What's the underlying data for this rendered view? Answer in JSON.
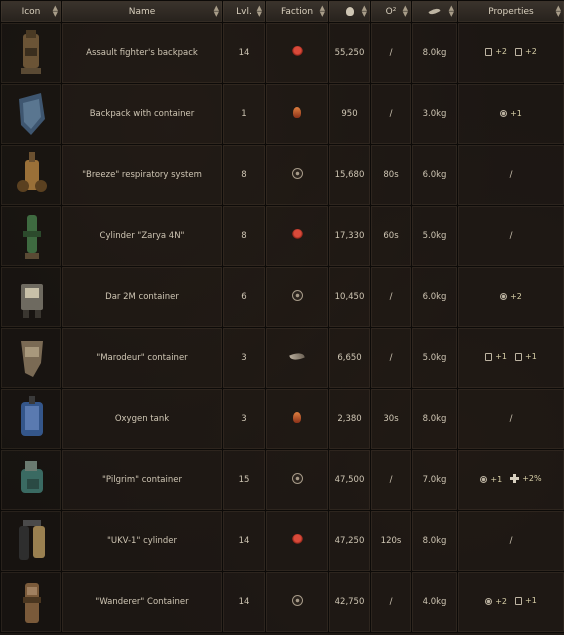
{
  "headers": {
    "icon": "Icon",
    "name": "Name",
    "level": "Lvl.",
    "faction": "Faction",
    "o2": "O²",
    "properties": "Properties"
  },
  "rows": [
    {
      "name": "Assault fighter's backpack",
      "level": "14",
      "faction": "star-icon",
      "price": "55,250",
      "o2": "/",
      "weight": "8.0kg",
      "props": [
        {
          "icon": "container-icon",
          "val": "+2"
        },
        {
          "icon": "jar-icon",
          "val": "+2"
        }
      ]
    },
    {
      "name": "Backpack with container",
      "level": "1",
      "faction": "fire-icon",
      "price": "950",
      "o2": "/",
      "weight": "3.0kg",
      "props": [
        {
          "icon": "eye-icon",
          "val": "+1"
        }
      ]
    },
    {
      "name": "\"Breeze\" respiratory system",
      "level": "8",
      "faction": "wheel-icon",
      "price": "15,680",
      "o2": "80s",
      "weight": "6.0kg",
      "props_text": "/"
    },
    {
      "name": "Cylinder \"Zarya 4N\"",
      "level": "8",
      "faction": "star-icon",
      "price": "17,330",
      "o2": "60s",
      "weight": "5.0kg",
      "props_text": "/"
    },
    {
      "name": "Dar 2M container",
      "level": "6",
      "faction": "wheel-icon",
      "price": "10,450",
      "o2": "/",
      "weight": "6.0kg",
      "props": [
        {
          "icon": "eye-icon",
          "val": "+2"
        }
      ]
    },
    {
      "name": "\"Marodeur\" container",
      "level": "3",
      "faction": "wing-icon",
      "price": "6,650",
      "o2": "/",
      "weight": "5.0kg",
      "props": [
        {
          "icon": "container-icon",
          "val": "+1"
        },
        {
          "icon": "jar-icon",
          "val": "+1"
        }
      ]
    },
    {
      "name": "Oxygen tank",
      "level": "3",
      "faction": "fire-icon",
      "price": "2,380",
      "o2": "30s",
      "weight": "8.0kg",
      "props_text": "/"
    },
    {
      "name": "\"Pilgrim\" container",
      "level": "15",
      "faction": "wheel-icon",
      "price": "47,500",
      "o2": "/",
      "weight": "7.0kg",
      "props": [
        {
          "icon": "eye-icon",
          "val": "+1"
        },
        {
          "icon": "cross-icon",
          "val": "+2%"
        }
      ]
    },
    {
      "name": "\"UKV-1\" cylinder",
      "level": "14",
      "faction": "star-icon",
      "price": "47,250",
      "o2": "120s",
      "weight": "8.0kg",
      "props_text": "/"
    },
    {
      "name": "\"Wanderer\" Container",
      "level": "14",
      "faction": "wheel-icon",
      "price": "42,750",
      "o2": "/",
      "weight": "4.0kg",
      "props": [
        {
          "icon": "eye-icon",
          "val": "+2"
        },
        {
          "icon": "jar-icon",
          "val": "+1"
        }
      ]
    }
  ],
  "item_icons": [
    "backpack-icon",
    "shield-pack-icon",
    "respirator-icon",
    "cylinder-icon",
    "container-icon",
    "marodeur-icon",
    "oxygen-tank-icon",
    "pilgrim-icon",
    "ukv-cylinder-icon",
    "wanderer-icon"
  ],
  "colors": {
    "header_bg": "#2e2822",
    "cell_bg": "#1e1814",
    "text": "#cfc6b4",
    "prop_text": "#d8d0a8"
  }
}
